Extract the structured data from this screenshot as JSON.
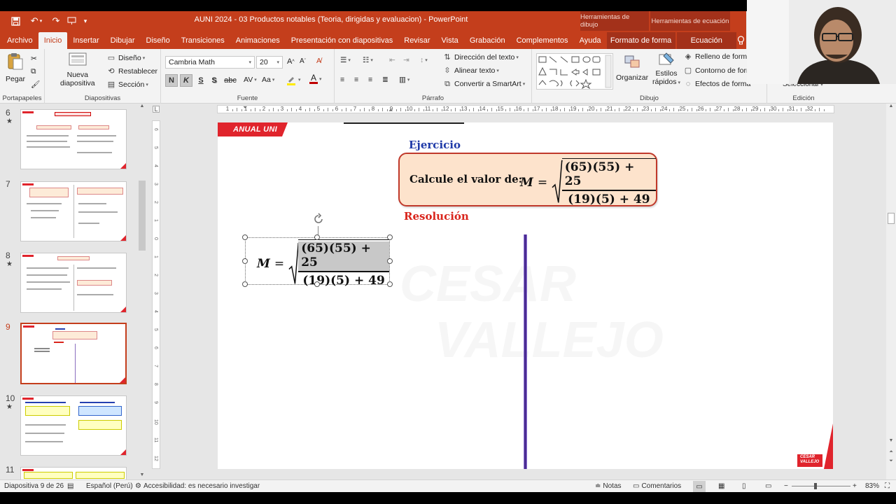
{
  "window": {
    "title": "AUNI 2024 - 03 Productos notables (Teoria, dirigidas y evaluacion)  -  PowerPoint",
    "context_tabs": [
      "Herramientas de dibujo",
      "Herramientas de ecuación"
    ]
  },
  "ribbon": {
    "tabs": [
      "Archivo",
      "Inicio",
      "Insertar",
      "Dibujar",
      "Diseño",
      "Transiciones",
      "Animaciones",
      "Presentación con diapositivas",
      "Revisar",
      "Vista",
      "Grabación",
      "Complementos",
      "Ayuda",
      "Formato de forma",
      "Ecuación"
    ],
    "active_tab": "Inicio",
    "portapapeles": {
      "paste_label": "Pegar",
      "group_label": "Portapapeles"
    },
    "diapositivas": {
      "new_slide_label_1": "Nueva",
      "new_slide_label_2": "diapositiva",
      "layout_label": "Diseño",
      "reset_label": "Restablecer",
      "section_label": "Sección",
      "group_label": "Diapositivas"
    },
    "fuente": {
      "font_name": "Cambria Math",
      "font_size": "20",
      "bold": "N",
      "italic": "K",
      "underline": "S",
      "shadow": "S",
      "strike": "abc",
      "group_label": "Fuente"
    },
    "parrafo": {
      "text_direction": "Dirección del texto",
      "align_text": "Alinear texto",
      "convert_smartart": "Convertir a SmartArt",
      "group_label": "Párrafo"
    },
    "dibujo": {
      "arrange_label": "Organizar",
      "styles_label_1": "Estilos",
      "styles_label_2": "rápidos",
      "fill_label": "Relleno de forma",
      "outline_label": "Contorno de forma",
      "effects_label": "Efectos de forma",
      "group_label": "Dibujo"
    },
    "edicion": {
      "select_label": "Seleccionar",
      "group_label": "Edición"
    }
  },
  "thumbnails": [
    {
      "number": "6",
      "star": "★",
      "selected": false
    },
    {
      "number": "7",
      "star": "",
      "selected": false
    },
    {
      "number": "8",
      "star": "★",
      "selected": false
    },
    {
      "number": "9",
      "star": "",
      "selected": true
    },
    {
      "number": "10",
      "star": "★",
      "selected": false
    },
    {
      "number": "11",
      "star": "",
      "selected": false
    }
  ],
  "ruler": {
    "ticks": [
      "1",
      "1",
      "2",
      "3",
      "4",
      "5",
      "6",
      "7",
      "8",
      "9",
      "10",
      "11",
      "12",
      "13",
      "14",
      "15",
      "16",
      "17",
      "18",
      "19",
      "20",
      "21",
      "22",
      "23",
      "24",
      "25",
      "26",
      "27",
      "28",
      "29",
      "30",
      "31",
      "32"
    ]
  },
  "slide": {
    "banner": "ANUAL UNI",
    "exercise_title": "Ejercicio",
    "prompt_label": "Calcule el valor de:",
    "eq_var": "M",
    "eq_equals": "=",
    "eq_numerator": "(65)(55) + 25",
    "eq_denominator": "(19)(5) + 49",
    "resolution_title": "Resolución",
    "watermark_line1": "CESAR",
    "watermark_line2": "VALLEJO",
    "logo_line1": "CESAR",
    "logo_line2": "VALLEJO",
    "colors": {
      "banner_red": "#e0242c",
      "title_blue": "#1f3aa8",
      "resolution_red": "#d9251c",
      "box_fill": "#fde3cc",
      "box_border": "#c0392b",
      "divider_purple": "#6a3fa0"
    }
  },
  "statusbar": {
    "slide_info": "Diapositiva 9 de 26",
    "language": "Español (Perú)",
    "accessibility": "Accesibilidad: es necesario investigar",
    "notes": "Notas",
    "comments": "Comentarios",
    "zoom_label": "83%",
    "zoom_value": 83
  },
  "icons": [
    "save-icon",
    "undo-icon",
    "redo-icon",
    "lightbulb-icon",
    "paste-icon",
    "new-slide-icon",
    "rotate-handle-icon",
    "notes-icon",
    "comments-icon",
    "accessibility-icon"
  ]
}
